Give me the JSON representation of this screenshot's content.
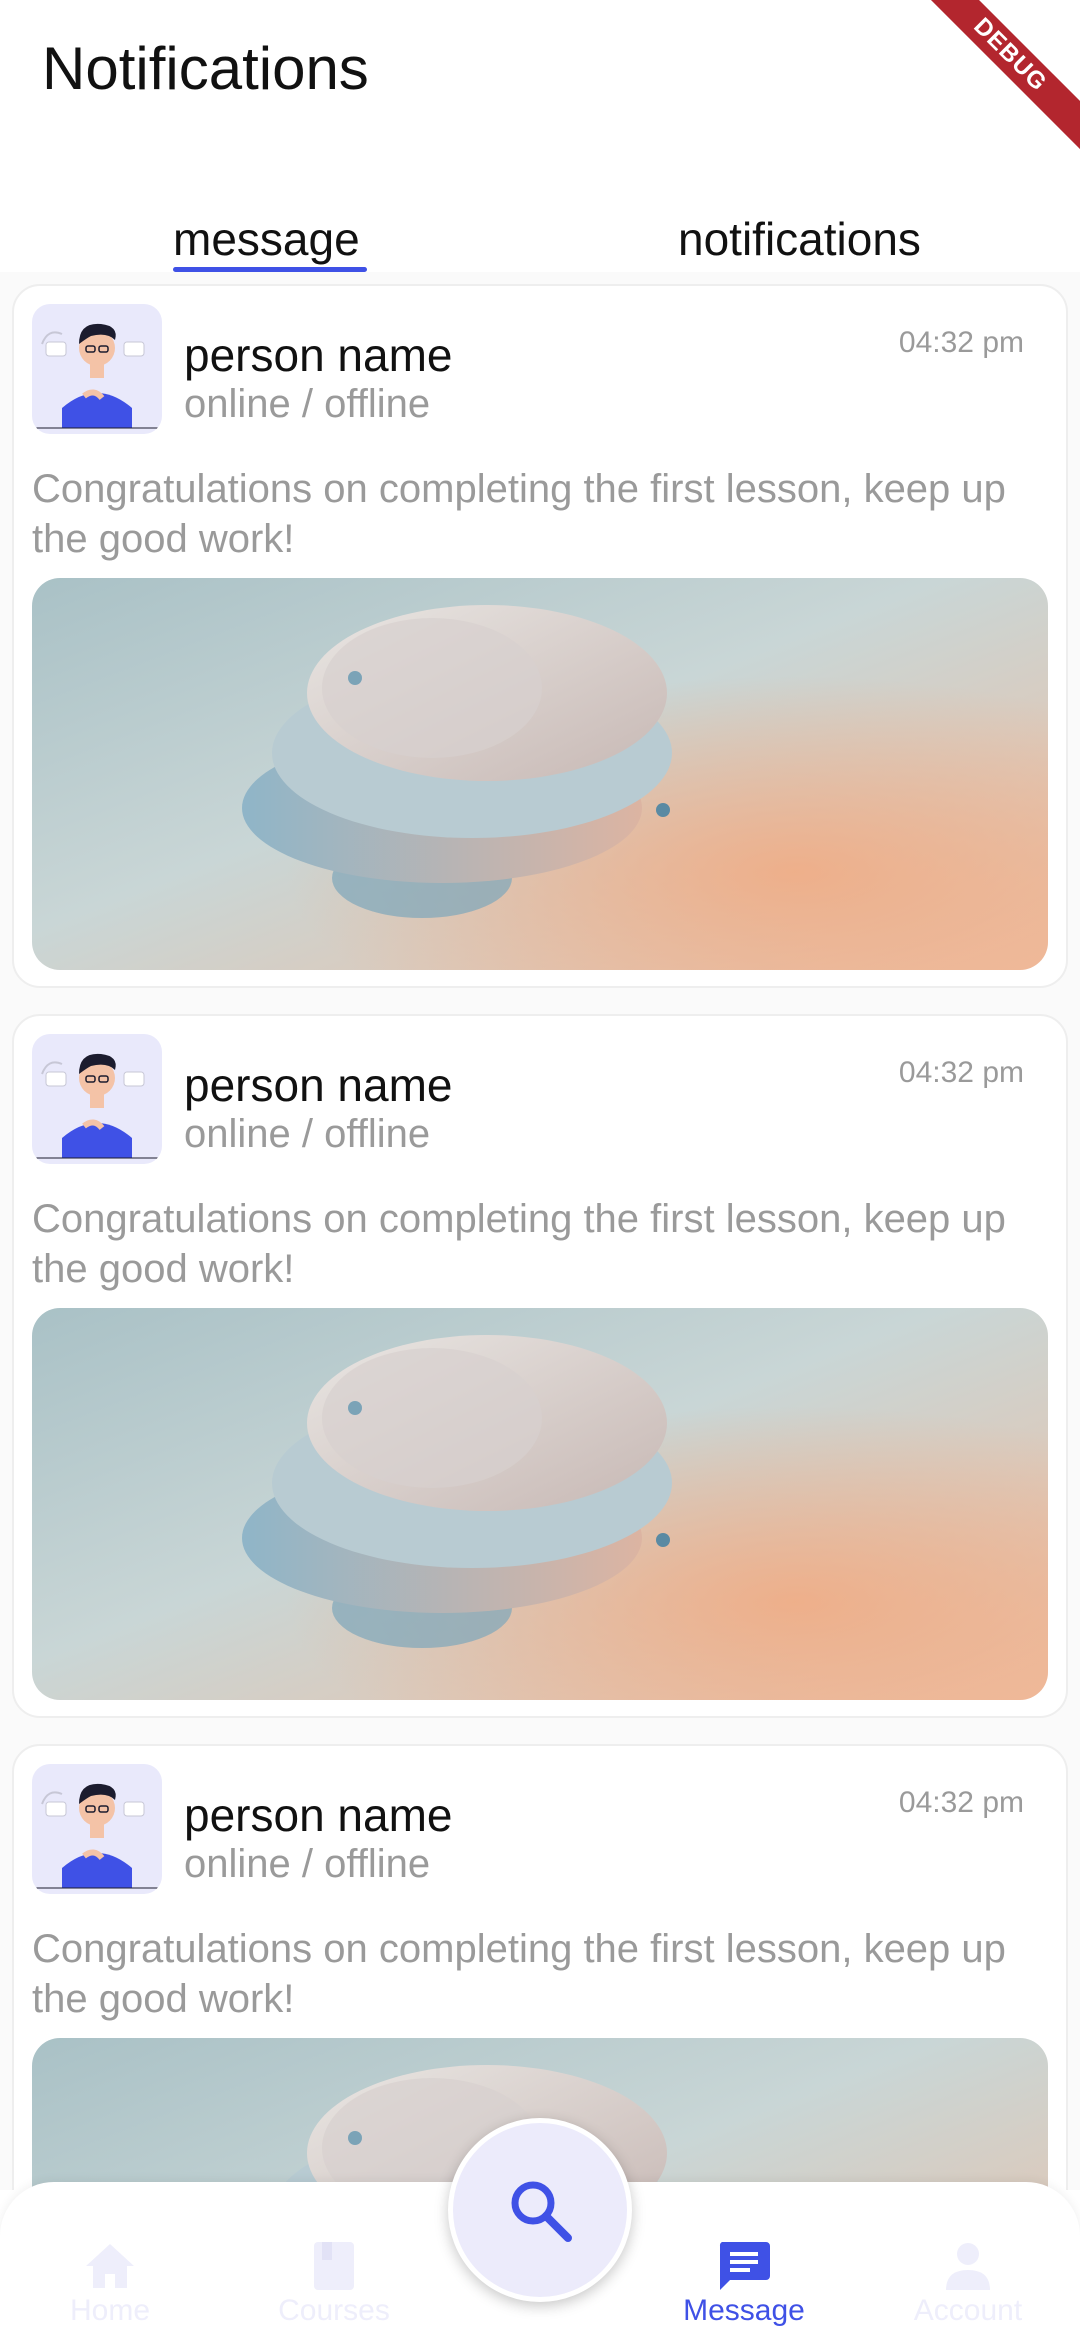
{
  "header": {
    "title": "Notifications",
    "debug_banner": "DEBUG"
  },
  "tabs": [
    {
      "label": "message",
      "active": true
    },
    {
      "label": "notifications",
      "active": false
    }
  ],
  "cards": [
    {
      "name": "person name",
      "status": "online / offline",
      "time": "04:32 pm",
      "message": "Congratulations on completing the first lesson, keep up the good work!"
    },
    {
      "name": "person name",
      "status": "online / offline",
      "time": "04:32 pm",
      "message": "Congratulations on completing the first lesson, keep up the good work!"
    },
    {
      "name": "person name",
      "status": "online / offline",
      "time": "04:32 pm",
      "message": "Congratulations on completing the first lesson, keep up the good work!"
    }
  ],
  "bottom_nav": {
    "items": [
      {
        "label": "Home",
        "icon": "home-icon",
        "active": false
      },
      {
        "label": "Courses",
        "icon": "book-icon",
        "active": false
      },
      {
        "label": "Message",
        "icon": "chat-icon",
        "active": true
      },
      {
        "label": "Account",
        "icon": "person-icon",
        "active": false
      }
    ],
    "fab_icon": "search-icon"
  },
  "colors": {
    "accent": "#3f51e6",
    "muted_text": "#9a9a9a",
    "avatar_bg": "#e9e9fb"
  }
}
